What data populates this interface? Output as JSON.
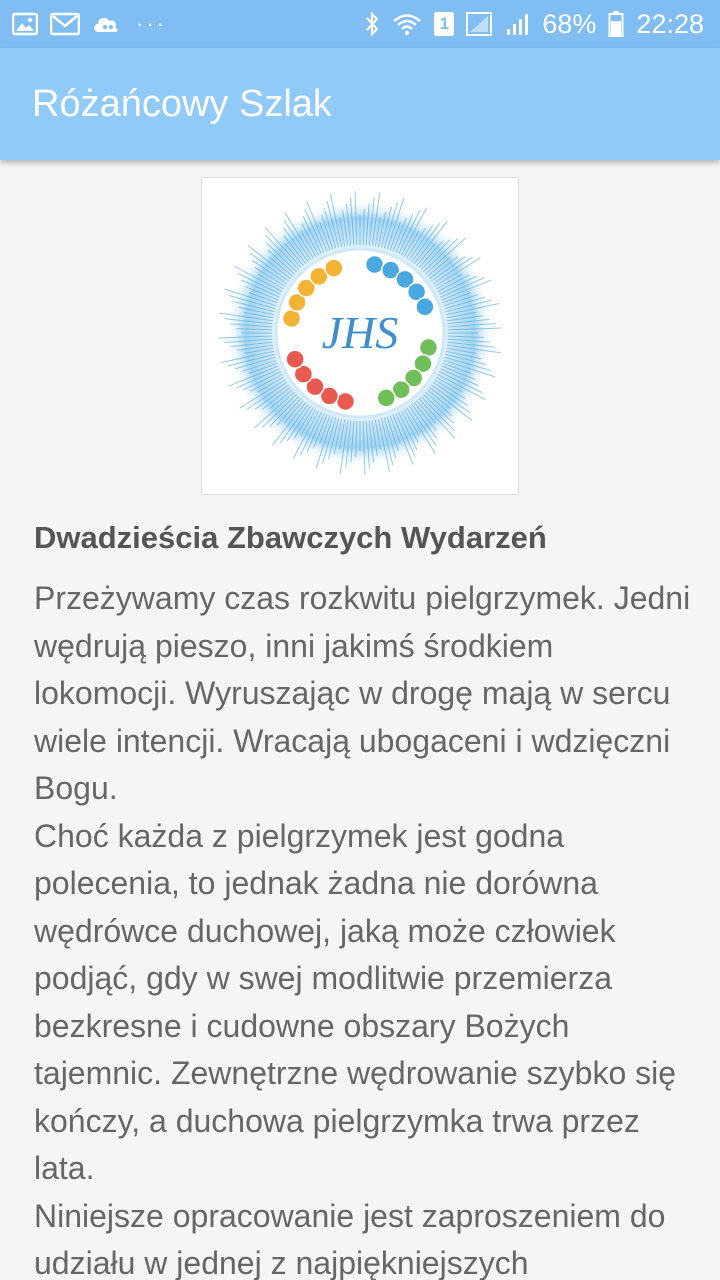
{
  "status_bar": {
    "left_icons": [
      "image-icon",
      "gmail-icon",
      "cloud-game-icon"
    ],
    "more": "···",
    "sim": "1",
    "battery": "68%",
    "time": "22:28"
  },
  "app_bar": {
    "title": "Różańcowy Szlak"
  },
  "logo": {
    "monogram": "JHS"
  },
  "article": {
    "heading": "Dwadzieścia Zbawczych Wydarzeń",
    "paragraphs": [
      "Przeżywamy czas rozkwitu pielgrzymek. Jedni wędrują pieszo, inni jakimś środkiem lokomocji. Wyruszając w drogę mają w sercu wiele intencji. Wracają ubogaceni i wdzięczni Bogu.",
      "Choć każda z pielgrzymek jest godna polecenia, to jednak żadna nie dorówna wędrówce duchowej, jaką może człowiek podjąć, gdy w swej modlitwie przemierza bezkresne i cudowne obszary Bożych tajemnic. Zewnętrzne wędrowanie szybko się kończy, a duchowa pielgrzymka trwa przez lata.",
      "Niniejsze opracowanie jest zaproszeniem do udziału w jednej z najpiękniejszych"
    ]
  },
  "colors": {
    "status_bar": "#7fbdf2",
    "app_bar": "#90caf9",
    "background": "#f5f5f5",
    "joyful": "#f5b335",
    "luminous": "#4aa8e0",
    "sorrowful": "#e85a50",
    "glorious": "#6fbe5a"
  }
}
